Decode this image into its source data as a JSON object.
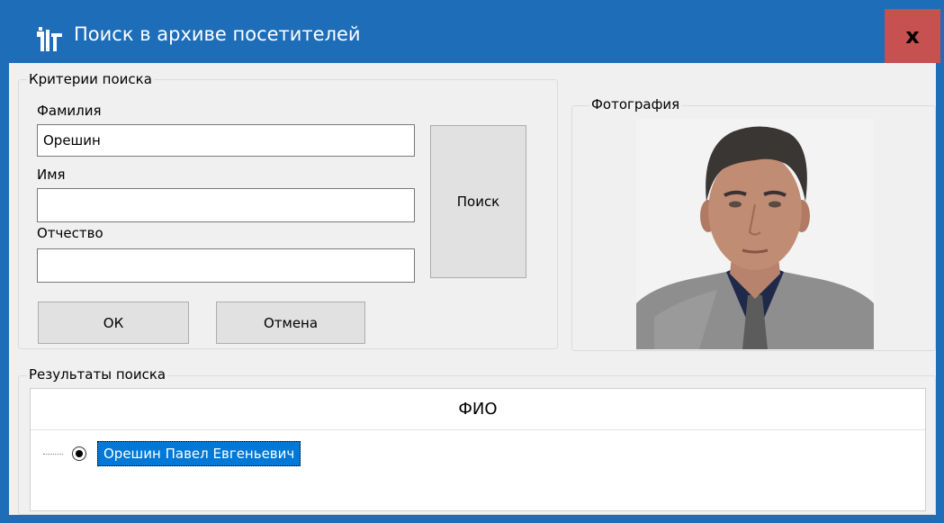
{
  "window": {
    "title": "Поиск в архиве посетителей",
    "close_label": "x",
    "accent_color": "#1e6db8",
    "close_color": "#c75050"
  },
  "criteria": {
    "group_label": "Критерии поиска",
    "last_name_label": "Фамилия",
    "last_name_value": "Орешин",
    "first_name_label": "Имя",
    "first_name_value": "",
    "patronymic_label": "Отчество",
    "patronymic_value": "",
    "search_button": "Поиск",
    "ok_button": "ОК",
    "cancel_button": "Отмена"
  },
  "photo": {
    "group_label": "Фотография"
  },
  "results": {
    "group_label": "Результаты поиска",
    "column_header": "ФИО",
    "items": [
      {
        "label": "Орешин Павел Евгеньевич",
        "selected": true
      }
    ],
    "selection_color": "#0078d7"
  }
}
